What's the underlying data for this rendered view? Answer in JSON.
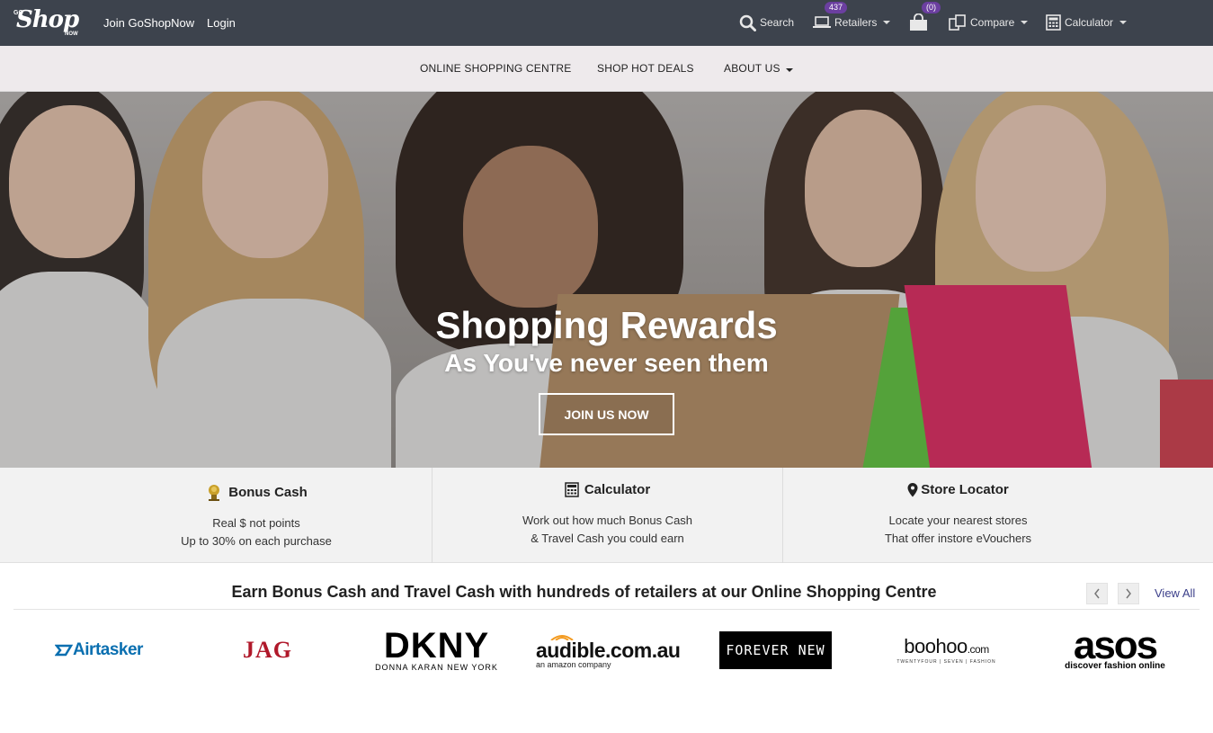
{
  "header": {
    "logo": {
      "go": "GO",
      "shop": "Shop",
      "now": "NOW"
    },
    "join_label": "Join GoShopNow",
    "login_label": "Login",
    "search_label": "Search",
    "retailers_label": "Retailers",
    "retailers_count": "437",
    "cart_count": "(0)",
    "compare_label": "Compare",
    "calculator_label": "Calculator"
  },
  "subnav": {
    "items": [
      "ONLINE SHOPPING CENTRE",
      "SHOP HOT DEALS",
      "ABOUT US"
    ]
  },
  "hero": {
    "title": "Shopping Rewards",
    "subtitle": "As You've never seen them",
    "cta_label": "JOIN US NOW"
  },
  "features": [
    {
      "icon": "piggy-bank-icon",
      "title": "Bonus Cash",
      "lines": [
        "Real $ not points",
        "Up to 30% on each purchase"
      ]
    },
    {
      "icon": "calculator-icon",
      "title": "Calculator",
      "lines": [
        "Work out how much Bonus Cash",
        "& Travel Cash you could earn"
      ]
    },
    {
      "icon": "map-marker-icon",
      "title": "Store Locator",
      "lines": [
        "Locate your nearest stores",
        "That offer instore eVouchers"
      ]
    }
  ],
  "retailers": {
    "title": "Earn Bonus Cash and Travel Cash with hundreds of retailers at our Online Shopping Centre",
    "view_all_label": "View All",
    "prev_icon": "chevron-left-icon",
    "next_icon": "chevron-right-icon",
    "logos": {
      "airtasker": "Airtasker",
      "jag": "JAG",
      "dkny": "DKNY",
      "dkny_sub": "DONNA KARAN NEW YORK",
      "audible": "audible.com.au",
      "audible_sub": "an amazon company",
      "forever_new": "FOREVER NEW",
      "boohoo": "boohoo",
      "boohoo_dotcom": ".com",
      "boohoo_sub": "TWENTYFOUR | SEVEN | FASHION",
      "asos": "asos",
      "asos_sub": "discover fashion online"
    }
  },
  "colors": {
    "topbar": "#3d434d",
    "subnav": "#eeeaec",
    "badge": "#6b3fa0",
    "features_bg": "#f2f2f2",
    "airtasker": "#0a6fb0",
    "jag": "#b0182a",
    "view_all": "#3b3f8a"
  }
}
